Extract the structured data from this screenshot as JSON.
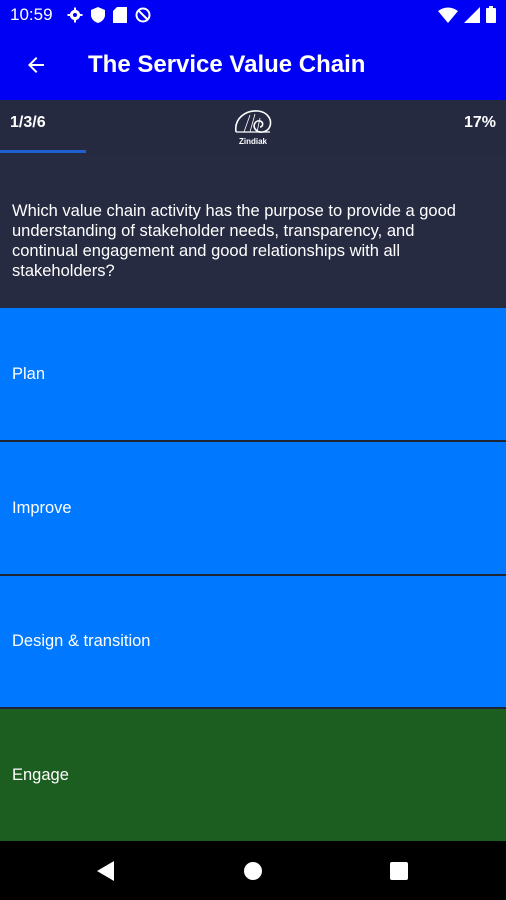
{
  "status_bar": {
    "time": "10:59",
    "left_icons": [
      "gear-icon",
      "shield-icon",
      "sd-card-icon",
      "do-not-disturb-icon"
    ],
    "right_icons": [
      "wifi-icon",
      "signal-icon",
      "battery-icon"
    ]
  },
  "app_bar": {
    "title": "The Service Value Chain",
    "back_icon": "arrow-back-icon",
    "color": "#0000f5"
  },
  "progress": {
    "counter": "1/3/6",
    "percent_label": "17%",
    "fraction": 0.17,
    "logo_text": "Zindiak"
  },
  "question": {
    "text": "Which value chain activity has the purpose to provide a good understanding of stakeholder needs, transparency, and continual engagement and good relationships with all stakeholders?"
  },
  "options": [
    {
      "label": "Plan",
      "state": "default",
      "color": "#0078ff"
    },
    {
      "label": "Improve",
      "state": "default",
      "color": "#0078ff"
    },
    {
      "label": "Design & transition",
      "state": "default",
      "color": "#0078ff"
    },
    {
      "label": "Engage",
      "state": "correct",
      "color": "#1b5e20"
    }
  ],
  "nav_bar": {
    "buttons": [
      "back-triangle-icon",
      "home-circle-icon",
      "recents-square-icon"
    ]
  }
}
